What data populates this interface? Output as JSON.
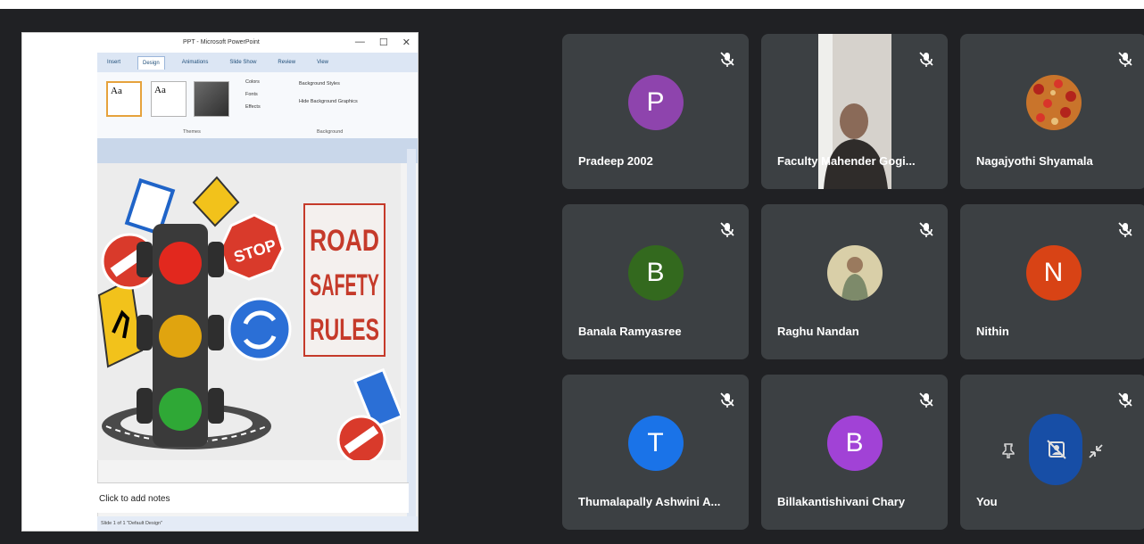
{
  "shared_screen": {
    "window_title": "PPT - Microsoft PowerPoint",
    "window_controls": [
      "—",
      "☐",
      "✕"
    ],
    "ribbon_tabs": [
      "Insert",
      "Design",
      "Animations",
      "Slide Show",
      "Review",
      "View"
    ],
    "active_tab": "Design",
    "theme_thumbs": [
      "Aa",
      "Aa"
    ],
    "ribbon_buttons": [
      "Colors",
      "Fonts",
      "Effects",
      "Background Styles",
      "Hide Background Graphics"
    ],
    "ribbon_groups": [
      "Themes",
      "Background"
    ],
    "slide": {
      "sign_stop": "STOP",
      "title_lines": [
        "ROAD",
        "SAFETY",
        "RULES"
      ]
    },
    "notes_placeholder": "Click to add notes",
    "status_text": "Slide 1 of 1  \"Default Design\""
  },
  "participants": [
    {
      "name": "Pradeep 2002",
      "initial": "P",
      "avatar_color": "#8e44ad",
      "kind": "letter",
      "muted": true
    },
    {
      "name": "Faculty Mahender Gogi...",
      "initial": "",
      "avatar_color": "",
      "kind": "video",
      "muted": true
    },
    {
      "name": "Nagajyothi Shyamala",
      "initial": "",
      "avatar_color": "",
      "kind": "photo",
      "muted": true
    },
    {
      "name": "Banala Ramyasree",
      "initial": "B",
      "avatar_color": "#33691e",
      "kind": "letter",
      "muted": true
    },
    {
      "name": "Raghu Nandan",
      "initial": "",
      "avatar_color": "",
      "kind": "photo",
      "muted": true
    },
    {
      "name": "Nithin",
      "initial": "N",
      "avatar_color": "#d84315",
      "kind": "letter",
      "muted": true
    },
    {
      "name": "Thumalapally Ashwini A...",
      "initial": "T",
      "avatar_color": "#1a73e8",
      "kind": "letter",
      "muted": true
    },
    {
      "name": "Billakantishivani Chary",
      "initial": "B",
      "avatar_color": "#a142d6",
      "kind": "letter",
      "muted": true
    },
    {
      "name": "You",
      "initial": "",
      "avatar_color": "#174ea6",
      "kind": "self",
      "muted": true
    }
  ],
  "icons": {
    "mic_off": "mic-off-icon",
    "pin": "pin-icon",
    "remove_background": "remove-background-icon",
    "minimize": "minimize-icon"
  },
  "colors": {
    "page_bg": "#202124",
    "tile_bg": "#3c4043"
  }
}
